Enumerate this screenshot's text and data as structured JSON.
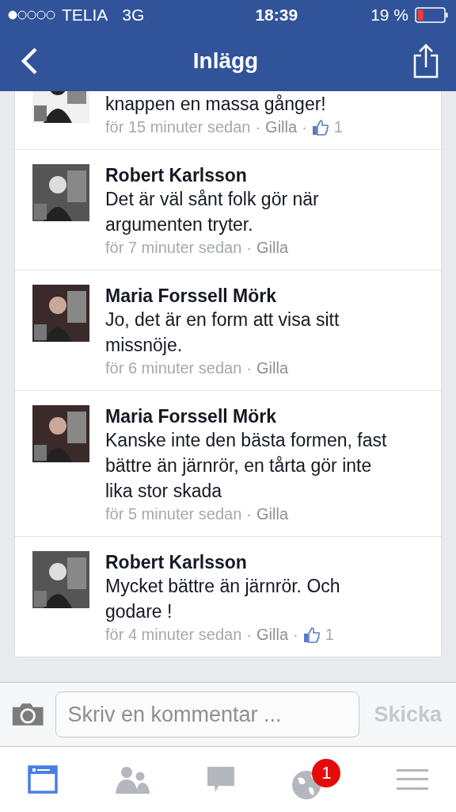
{
  "status_bar": {
    "carrier": "TELIA",
    "network": "3G",
    "time": "18:39",
    "battery": "19 %"
  },
  "nav": {
    "title": "Inlägg"
  },
  "comments": [
    {
      "text": "knappen en massa gånger!",
      "meta": [
        "för 15 minuter sedan",
        "·",
        "Gilla",
        "·"
      ],
      "likes": "1",
      "cut": true
    },
    {
      "name": "Robert Karlsson",
      "text": "Det är väl sånt folk gör när argumenten tryter.",
      "meta": [
        "för 7 minuter sedan",
        "·",
        "Gilla"
      ],
      "cut": false
    },
    {
      "name": "Maria Forssell Mörk",
      "text": "Jo, det är en form att visa sitt missnöje.",
      "meta": [
        "för 6 minuter sedan",
        "·",
        "Gilla"
      ],
      "cut": false
    },
    {
      "name": "Maria Forssell Mörk",
      "text": "Kanske inte den bästa formen, fast bättre än järnrör, en tårta gör inte lika stor skada",
      "meta": [
        "för 5 minuter sedan",
        "·",
        "Gilla"
      ],
      "cut": false
    },
    {
      "name": "Robert Karlsson",
      "text": "Mycket bättre än järnrör. Och godare !",
      "meta": [
        "för 4 minuter sedan",
        "·",
        "Gilla",
        "·"
      ],
      "likes": "1",
      "cut": false
    }
  ],
  "composer": {
    "placeholder": "Skriv en kommentar ...",
    "send": "Skicka"
  },
  "tabs": [
    {
      "kind": "feed",
      "selected": true
    },
    {
      "kind": "friends",
      "selected": false
    },
    {
      "kind": "messages",
      "selected": false
    },
    {
      "kind": "notifications",
      "selected": false,
      "badge": "1"
    },
    {
      "kind": "menu",
      "selected": false
    }
  ]
}
